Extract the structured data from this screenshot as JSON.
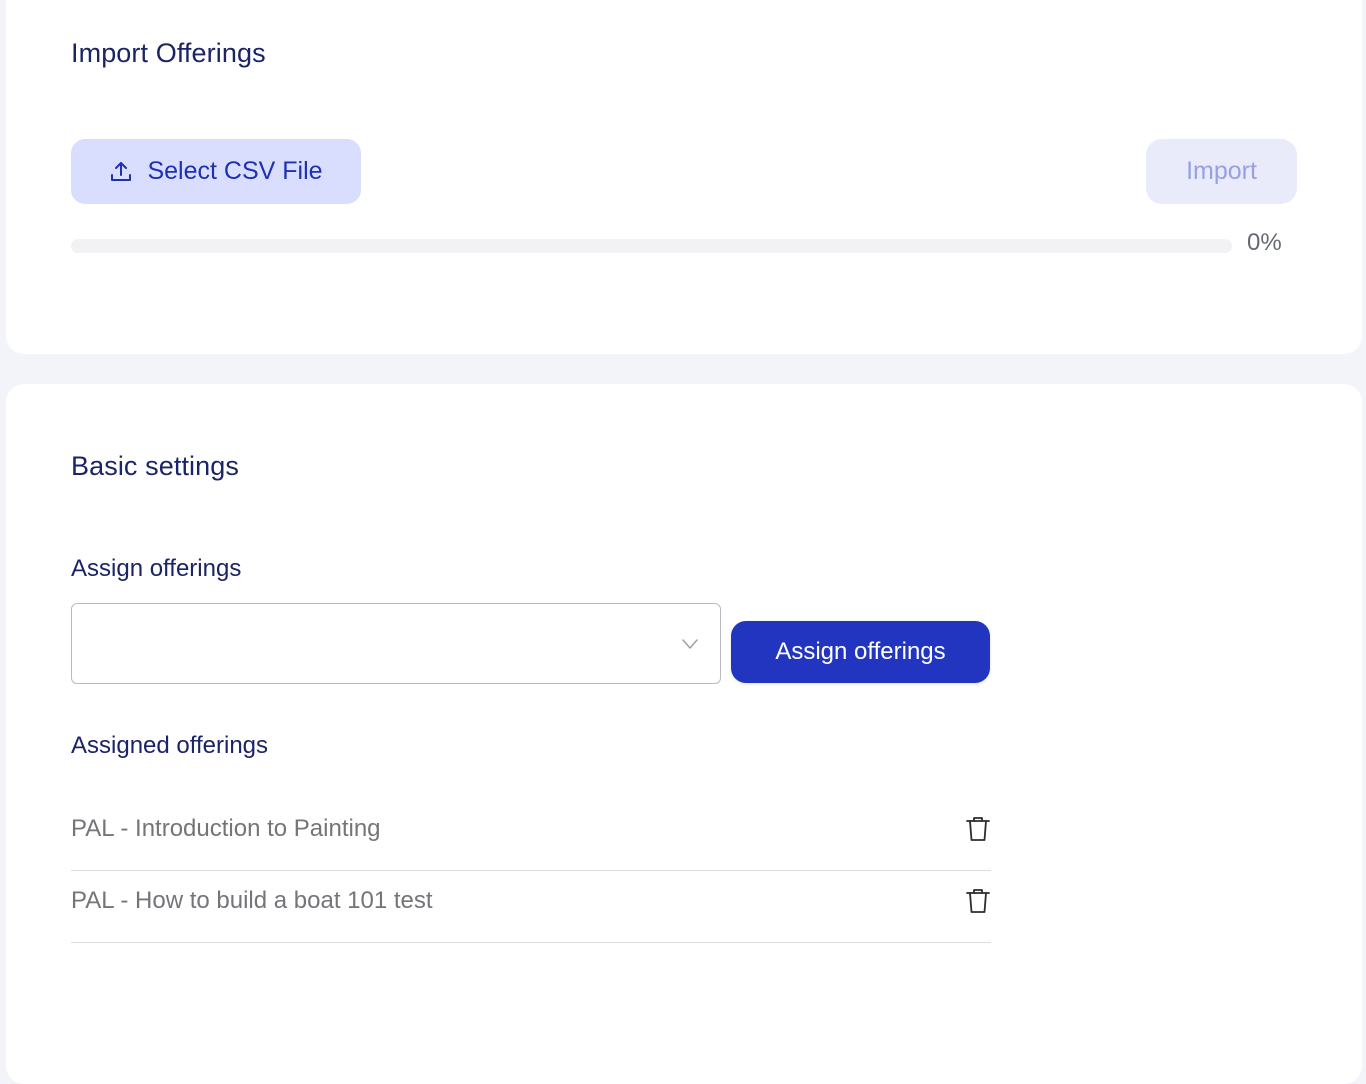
{
  "import_section": {
    "title": "Import Offerings",
    "select_csv_label": "Select CSV File",
    "select_csv_icon": "upload-icon",
    "import_label": "Import",
    "progress": 0,
    "progress_text": "0%"
  },
  "basic_settings": {
    "title": "Basic settings",
    "assign_label": "Assign offerings",
    "select_value": "",
    "select_icon": "chevron-down-icon",
    "assign_button_label": "Assign offerings",
    "assigned_label": "Assigned offerings",
    "assigned_items": [
      {
        "label": "PAL - Introduction to Painting",
        "icon": "trash-icon"
      },
      {
        "label": "PAL - How to build a boat 101 test",
        "icon": "trash-icon"
      }
    ]
  },
  "colors": {
    "page_background": "#f3f4f9",
    "heading": "#1b2466",
    "primary": "#2235c0",
    "primary_light": "#d9deff",
    "disabled_button": "#e9ebfb",
    "muted_text": "#737578"
  }
}
